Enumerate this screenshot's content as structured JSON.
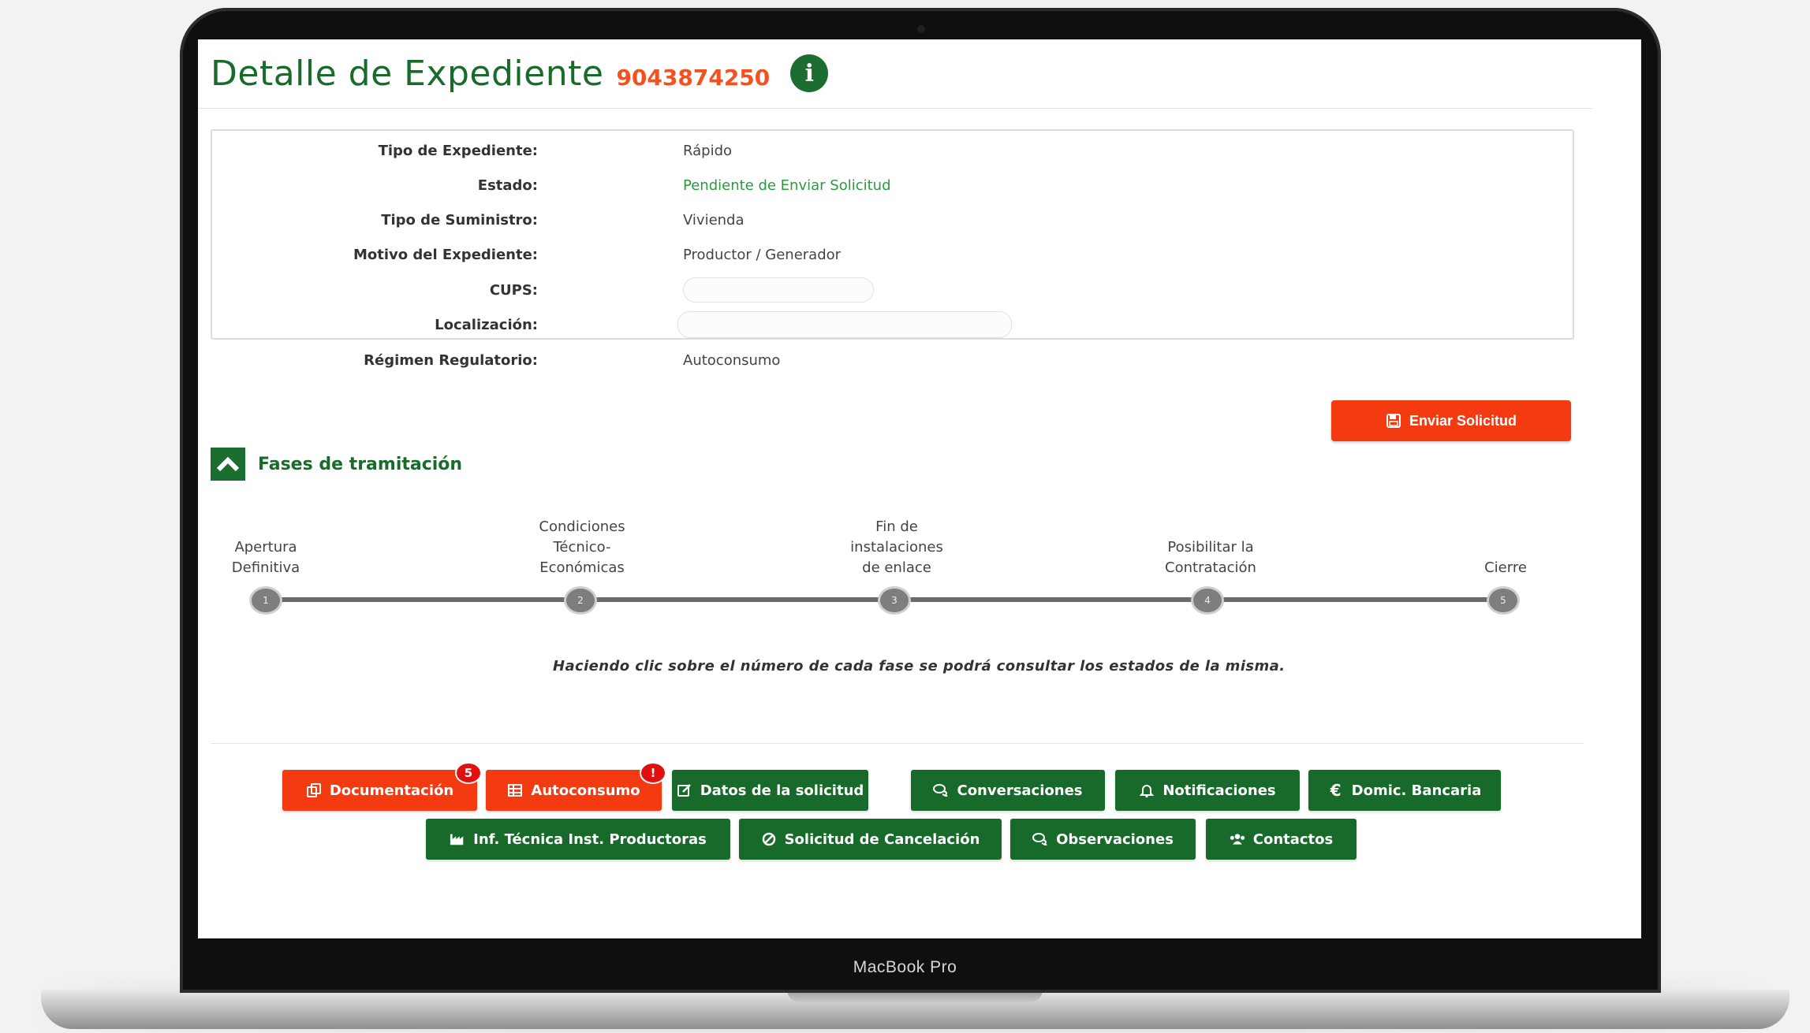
{
  "header": {
    "title": "Detalle de Expediente",
    "number": "9043874250"
  },
  "details": [
    {
      "label": "Tipo de Expediente:",
      "value": "Rápido"
    },
    {
      "label": "Estado:",
      "value": "Pendiente de Enviar Solicitud"
    },
    {
      "label": "Tipo de Suministro:",
      "value": "Vivienda"
    },
    {
      "label": "Motivo del Expediente:",
      "value": "Productor / Generador"
    },
    {
      "label": "CUPS:",
      "value": ""
    },
    {
      "label": "Localización:",
      "value": ""
    },
    {
      "label": "Régimen Regulatorio:",
      "value": "Autoconsumo"
    }
  ],
  "send_button": {
    "label": "Enviar Solicitud"
  },
  "phases": {
    "title": "Fases de tramitación",
    "items": [
      {
        "number": "1",
        "label_lines": [
          "Apertura",
          "Definitiva"
        ]
      },
      {
        "number": "2",
        "label_lines": [
          "Condiciones",
          "Técnico-",
          "Económicas"
        ]
      },
      {
        "number": "3",
        "label_lines": [
          "Fin de",
          "instalaciones",
          "de enlace"
        ]
      },
      {
        "number": "4",
        "label_lines": [
          "Posibilitar la",
          "Contratación"
        ]
      },
      {
        "number": "5",
        "label_lines": [
          "Cierre"
        ]
      }
    ],
    "hint": "Haciendo clic sobre el número de cada fase se podrá consultar los estados de la misma."
  },
  "tabs": [
    {
      "label": "Documentación",
      "icon": "copy-icon",
      "badge": "5",
      "color": "#f43a10"
    },
    {
      "label": "Autoconsumo",
      "icon": "table-icon",
      "badge": "!",
      "color": "#f43a10"
    },
    {
      "label": "Datos de la solicitud",
      "icon": "edit-icon",
      "color": "#176a29"
    },
    {
      "label": "Conversaciones",
      "icon": "chat-icon",
      "color": "#176a29"
    },
    {
      "label": "Notificaciones",
      "icon": "bell-icon",
      "color": "#176a29"
    },
    {
      "label": "Domic. Bancaria",
      "icon": "euro-icon",
      "color": "#176a29"
    },
    {
      "label": "Inf. Técnica Inst. Productoras",
      "icon": "factory-icon",
      "color": "#176a29"
    },
    {
      "label": "Solicitud de Cancelación",
      "icon": "ban-icon",
      "color": "#176a29"
    },
    {
      "label": "Observaciones",
      "icon": "chat-icon",
      "color": "#176a29"
    },
    {
      "label": "Contactos",
      "icon": "users-icon",
      "color": "#176a29"
    }
  ],
  "device": {
    "label": "MacBook Pro"
  }
}
